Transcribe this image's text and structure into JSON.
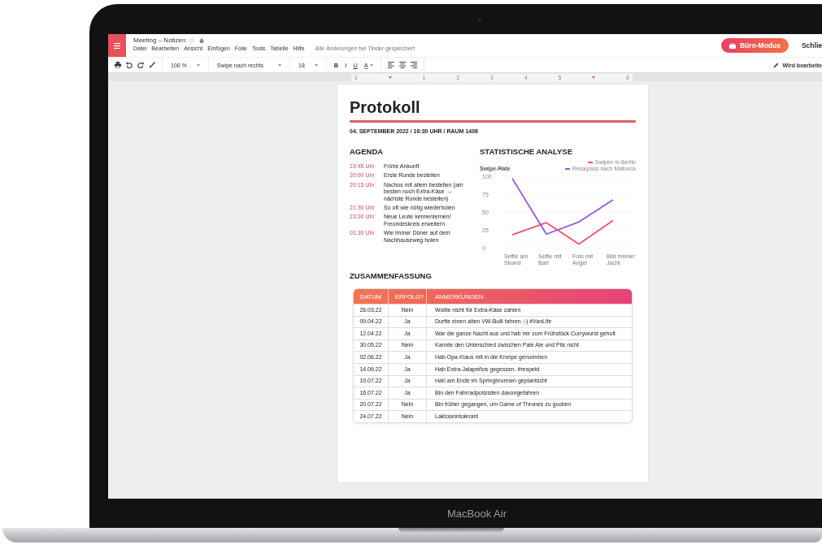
{
  "device": {
    "label": "MacBook Air"
  },
  "app": {
    "title": "Meeting – Notizen",
    "menu": [
      "Datei",
      "Bearbeiten",
      "Ansicht",
      "Einfügen",
      "Folie",
      "Tools",
      "Tabelle",
      "Hilfe"
    ],
    "save_status": "Alle Änderungen bei Tinder gespeichert",
    "mode_button": "Büro-Modus",
    "close_button": "Schlie"
  },
  "toolbar": {
    "zoom": "100 %",
    "style": "Swipe nach rechts",
    "font_size": "18",
    "format_buttons": [
      "B",
      "I",
      "U",
      "A"
    ],
    "edit_status": "Wird bearbeite"
  },
  "ruler": {
    "labels": [
      "1",
      "1",
      "2",
      "3",
      "4",
      "5",
      "6"
    ]
  },
  "document": {
    "title": "Protokoll",
    "subtitle": "04. SEPTEMBER 2022 / 16:30 UHR / RAUM 1408",
    "agenda": {
      "heading": "AGENDA",
      "items": [
        {
          "time": "19:45 Uhr",
          "text": "Frühe Ankunft"
        },
        {
          "time": "20:00 Uhr",
          "text": "Erste Runde bestellen"
        },
        {
          "time": "20:15 Uhr",
          "text": "Nachos mit allem bestellen (am besten noch Extra-Käse → nächste Runde bestellen)"
        },
        {
          "time": "21:30 Uhr",
          "text": "So oft wie nötig wiederholen"
        },
        {
          "time": "23:30 Uhr",
          "text": "Neue Leute kennenlernen/ Freundeskreis erweitern"
        },
        {
          "time": "01:30 Uhr",
          "text": "Wie immer Döner auf dem Nachhauseweg holen"
        }
      ]
    },
    "analysis": {
      "heading": "STATISTISCHE ANALYSE",
      "chart_data": {
        "type": "line",
        "legend": "upper right",
        "ylabel": "Swipe-Rate",
        "categories": [
          "Selfie am Strand",
          "Selfie mit Bart",
          "Foto mit Angel",
          "Bild meiner Jacht"
        ],
        "yticks": [
          0,
          25,
          50,
          75,
          100
        ],
        "ylim": [
          0,
          100
        ],
        "series": [
          {
            "name": "Swipen in Berlin",
            "color": "#e9556a",
            "values": [
              18,
              35,
              5,
              38
            ]
          },
          {
            "name": "Reisepass nach Mallorca",
            "color": "#9b55dd",
            "values": [
              97,
              19,
              36,
              67
            ]
          }
        ]
      }
    },
    "summary": {
      "heading": "ZUSAMMENFASSUNG",
      "columns": [
        "DATUM",
        "ERFOLG?",
        "ANMERKUNGEN"
      ],
      "rows": [
        [
          "26.03.22",
          "Nein",
          "Wollte nicht für Extra-Käse zahlen"
        ],
        [
          "09.04.22",
          "Ja",
          "Durfte einen alten VW-Bulli fahren :-) #VanLife"
        ],
        [
          "12.04.22",
          "Ja",
          "War die ganze Nacht aus und hab mir zum Frühstück Currywurst geholt"
        ],
        [
          "30.05.22",
          "Nein",
          "Kannte den Unterschied zwischen Pale Ale und Pils nicht"
        ],
        [
          "02.06.22",
          "Ja",
          "Hab Opa Klaus mit in die Kneipe genommen"
        ],
        [
          "14.06.22",
          "Ja",
          "Hab Extra-Jalapeños gegessen. #respekt"
        ],
        [
          "10.07.22",
          "Ja",
          "Hab am Ende im Springbrunnen geplantscht"
        ],
        [
          "16.07.22",
          "Ja",
          "Bin den Fahrradpolizisten davongefahren"
        ],
        [
          "20.07.22",
          "Nein",
          "Bin früher gegangen, um Game of Thrones zu gucken"
        ],
        [
          "24.07.22",
          "Nein",
          "Laktoseintolerant"
        ]
      ]
    }
  }
}
